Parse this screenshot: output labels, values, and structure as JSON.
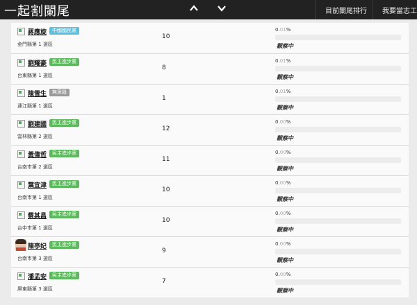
{
  "navbar": {
    "brand": "一起割闌尾",
    "links": [
      "目前闌尾排行",
      "我要當志工"
    ],
    "arrows": [
      "chevron-up-icon",
      "chevron-down-icon"
    ]
  },
  "colors": {
    "green_party": "#5cb85c",
    "blue_party": "#5bc0de",
    "gray_party": "#999999",
    "navbar": "#222222"
  },
  "rows": [
    {
      "name": "蔣應旋",
      "party": "中國國民黨",
      "party_color": "#5bc0de",
      "district": "金門縣第 1 選區",
      "count": "10",
      "pct_lead": "0.",
      "pct_muted": "01",
      "pct_tail": "%",
      "progress": 0.0001,
      "status": "觀察中",
      "avatar": "placeholder"
    },
    {
      "name": "劉耀豪",
      "party": "民主進步黨",
      "party_color": "#5cb85c",
      "district": "台東縣第 1 選區",
      "count": "8",
      "pct_lead": "0.",
      "pct_muted": "01",
      "pct_tail": "%",
      "progress": 0.0001,
      "status": "觀察中",
      "avatar": "placeholder"
    },
    {
      "name": "陳雪生",
      "party": "無黨籍",
      "party_color": "#999999",
      "district": "連江縣第 1 選區",
      "count": "1",
      "pct_lead": "0.",
      "pct_muted": "01",
      "pct_tail": "%",
      "progress": 0.0001,
      "status": "觀察中",
      "avatar": "placeholder"
    },
    {
      "name": "劉建國",
      "party": "民主進步黨",
      "party_color": "#5cb85c",
      "district": "雲林縣第 2 選區",
      "count": "12",
      "pct_lead": "0.",
      "pct_muted": "00",
      "pct_tail": "%",
      "progress": 0.0,
      "status": "觀察中",
      "avatar": "placeholder"
    },
    {
      "name": "黃偉哲",
      "party": "民主進步黨",
      "party_color": "#5cb85c",
      "district": "台南市第 2 選區",
      "count": "11",
      "pct_lead": "0.",
      "pct_muted": "00",
      "pct_tail": "%",
      "progress": 0.0,
      "status": "觀察中",
      "avatar": "placeholder"
    },
    {
      "name": "葉宜津",
      "party": "民主進步黨",
      "party_color": "#5cb85c",
      "district": "台南市第 1 選區",
      "count": "10",
      "pct_lead": "0.",
      "pct_muted": "00",
      "pct_tail": "%",
      "progress": 0.0,
      "status": "觀察中",
      "avatar": "placeholder"
    },
    {
      "name": "蔡其昌",
      "party": "民主進步黨",
      "party_color": "#5cb85c",
      "district": "台中市第 1 選區",
      "count": "10",
      "pct_lead": "0.",
      "pct_muted": "00",
      "pct_tail": "%",
      "progress": 0.0,
      "status": "觀察中",
      "avatar": "placeholder"
    },
    {
      "name": "陳亭妃",
      "party": "民主進步黨",
      "party_color": "#5cb85c",
      "district": "台南市第 3 選區",
      "count": "9",
      "pct_lead": "0.",
      "pct_muted": "00",
      "pct_tail": "%",
      "progress": 0.0,
      "status": "觀察中",
      "avatar": "photo"
    },
    {
      "name": "潘孟安",
      "party": "民主進步黨",
      "party_color": "#5cb85c",
      "district": "屏東縣第 3 選區",
      "count": "7",
      "pct_lead": "0.",
      "pct_muted": "00",
      "pct_tail": "%",
      "progress": 0.0,
      "status": "觀察中",
      "avatar": "placeholder"
    }
  ]
}
